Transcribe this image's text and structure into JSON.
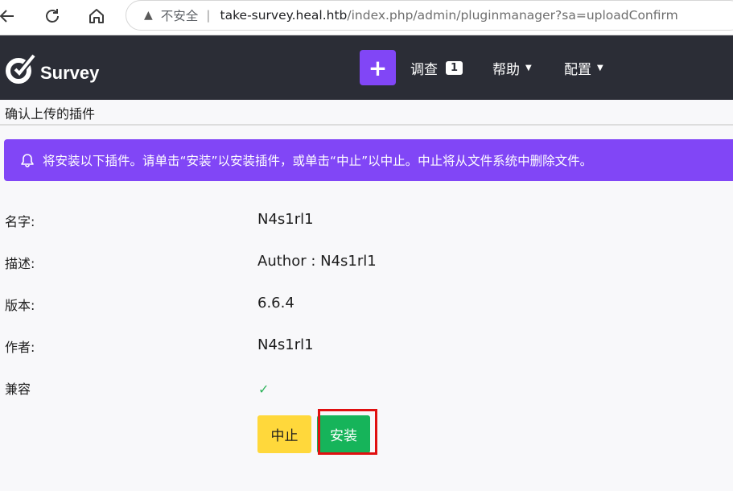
{
  "browser": {
    "insecure_label": "不安全",
    "separator": "|",
    "url_host": "take-survey.heal.htb",
    "url_path": "/index.php/admin/pluginmanager?sa=uploadConfirm"
  },
  "navbar": {
    "brand": "Survey",
    "new_button": "+",
    "surveys_label": "调查",
    "surveys_count": "1",
    "help_label": "帮助",
    "config_label": "配置"
  },
  "page": {
    "title": "确认上传的插件"
  },
  "alert": {
    "message": "将安装以下插件。请单击“安装”以安装插件，或单击“中止”以中止。中止将从文件系统中删除文件。"
  },
  "fields": {
    "name_label": "名字:",
    "name_value": "N4s1rl1",
    "description_label": "描述:",
    "description_value": "Author : N4s1rl1",
    "version_label": "版本:",
    "version_value": "6.6.4",
    "author_label": "作者:",
    "author_value": "N4s1rl1",
    "compatible_label": "兼容",
    "compatible_icon": "check-icon"
  },
  "buttons": {
    "abort": "中止",
    "install": "安装"
  },
  "colors": {
    "navbar_bg": "#2b2d36",
    "accent_purple": "#8146f6",
    "abort_yellow": "#ffd83b",
    "install_green": "#16b45a",
    "highlight_red": "#e01010"
  }
}
